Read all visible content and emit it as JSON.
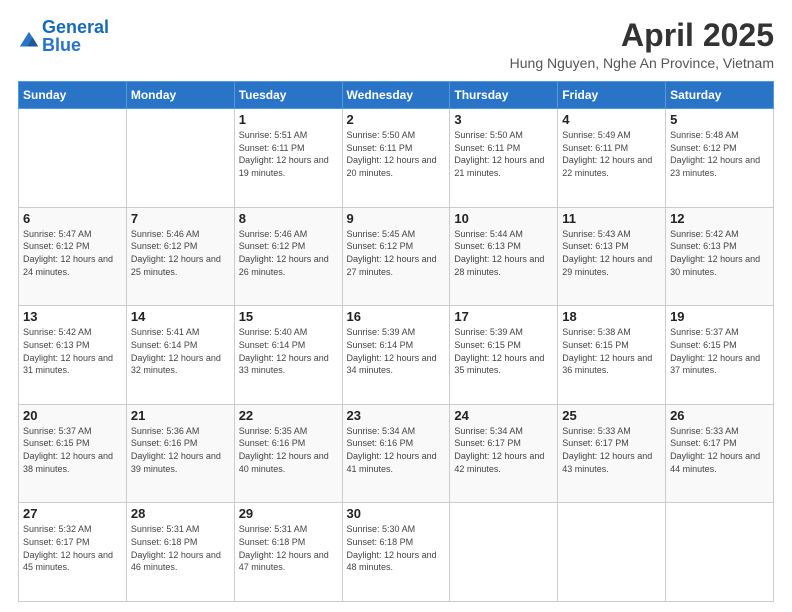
{
  "header": {
    "logo_general": "General",
    "logo_blue": "Blue",
    "month_title": "April 2025",
    "location": "Hung Nguyen, Nghe An Province, Vietnam"
  },
  "weekdays": [
    "Sunday",
    "Monday",
    "Tuesday",
    "Wednesday",
    "Thursday",
    "Friday",
    "Saturday"
  ],
  "weeks": [
    [
      {
        "day": "",
        "sunrise": "",
        "sunset": "",
        "daylight": ""
      },
      {
        "day": "",
        "sunrise": "",
        "sunset": "",
        "daylight": ""
      },
      {
        "day": "1",
        "sunrise": "Sunrise: 5:51 AM",
        "sunset": "Sunset: 6:11 PM",
        "daylight": "Daylight: 12 hours and 19 minutes."
      },
      {
        "day": "2",
        "sunrise": "Sunrise: 5:50 AM",
        "sunset": "Sunset: 6:11 PM",
        "daylight": "Daylight: 12 hours and 20 minutes."
      },
      {
        "day": "3",
        "sunrise": "Sunrise: 5:50 AM",
        "sunset": "Sunset: 6:11 PM",
        "daylight": "Daylight: 12 hours and 21 minutes."
      },
      {
        "day": "4",
        "sunrise": "Sunrise: 5:49 AM",
        "sunset": "Sunset: 6:11 PM",
        "daylight": "Daylight: 12 hours and 22 minutes."
      },
      {
        "day": "5",
        "sunrise": "Sunrise: 5:48 AM",
        "sunset": "Sunset: 6:12 PM",
        "daylight": "Daylight: 12 hours and 23 minutes."
      }
    ],
    [
      {
        "day": "6",
        "sunrise": "Sunrise: 5:47 AM",
        "sunset": "Sunset: 6:12 PM",
        "daylight": "Daylight: 12 hours and 24 minutes."
      },
      {
        "day": "7",
        "sunrise": "Sunrise: 5:46 AM",
        "sunset": "Sunset: 6:12 PM",
        "daylight": "Daylight: 12 hours and 25 minutes."
      },
      {
        "day": "8",
        "sunrise": "Sunrise: 5:46 AM",
        "sunset": "Sunset: 6:12 PM",
        "daylight": "Daylight: 12 hours and 26 minutes."
      },
      {
        "day": "9",
        "sunrise": "Sunrise: 5:45 AM",
        "sunset": "Sunset: 6:12 PM",
        "daylight": "Daylight: 12 hours and 27 minutes."
      },
      {
        "day": "10",
        "sunrise": "Sunrise: 5:44 AM",
        "sunset": "Sunset: 6:13 PM",
        "daylight": "Daylight: 12 hours and 28 minutes."
      },
      {
        "day": "11",
        "sunrise": "Sunrise: 5:43 AM",
        "sunset": "Sunset: 6:13 PM",
        "daylight": "Daylight: 12 hours and 29 minutes."
      },
      {
        "day": "12",
        "sunrise": "Sunrise: 5:42 AM",
        "sunset": "Sunset: 6:13 PM",
        "daylight": "Daylight: 12 hours and 30 minutes."
      }
    ],
    [
      {
        "day": "13",
        "sunrise": "Sunrise: 5:42 AM",
        "sunset": "Sunset: 6:13 PM",
        "daylight": "Daylight: 12 hours and 31 minutes."
      },
      {
        "day": "14",
        "sunrise": "Sunrise: 5:41 AM",
        "sunset": "Sunset: 6:14 PM",
        "daylight": "Daylight: 12 hours and 32 minutes."
      },
      {
        "day": "15",
        "sunrise": "Sunrise: 5:40 AM",
        "sunset": "Sunset: 6:14 PM",
        "daylight": "Daylight: 12 hours and 33 minutes."
      },
      {
        "day": "16",
        "sunrise": "Sunrise: 5:39 AM",
        "sunset": "Sunset: 6:14 PM",
        "daylight": "Daylight: 12 hours and 34 minutes."
      },
      {
        "day": "17",
        "sunrise": "Sunrise: 5:39 AM",
        "sunset": "Sunset: 6:15 PM",
        "daylight": "Daylight: 12 hours and 35 minutes."
      },
      {
        "day": "18",
        "sunrise": "Sunrise: 5:38 AM",
        "sunset": "Sunset: 6:15 PM",
        "daylight": "Daylight: 12 hours and 36 minutes."
      },
      {
        "day": "19",
        "sunrise": "Sunrise: 5:37 AM",
        "sunset": "Sunset: 6:15 PM",
        "daylight": "Daylight: 12 hours and 37 minutes."
      }
    ],
    [
      {
        "day": "20",
        "sunrise": "Sunrise: 5:37 AM",
        "sunset": "Sunset: 6:15 PM",
        "daylight": "Daylight: 12 hours and 38 minutes."
      },
      {
        "day": "21",
        "sunrise": "Sunrise: 5:36 AM",
        "sunset": "Sunset: 6:16 PM",
        "daylight": "Daylight: 12 hours and 39 minutes."
      },
      {
        "day": "22",
        "sunrise": "Sunrise: 5:35 AM",
        "sunset": "Sunset: 6:16 PM",
        "daylight": "Daylight: 12 hours and 40 minutes."
      },
      {
        "day": "23",
        "sunrise": "Sunrise: 5:34 AM",
        "sunset": "Sunset: 6:16 PM",
        "daylight": "Daylight: 12 hours and 41 minutes."
      },
      {
        "day": "24",
        "sunrise": "Sunrise: 5:34 AM",
        "sunset": "Sunset: 6:17 PM",
        "daylight": "Daylight: 12 hours and 42 minutes."
      },
      {
        "day": "25",
        "sunrise": "Sunrise: 5:33 AM",
        "sunset": "Sunset: 6:17 PM",
        "daylight": "Daylight: 12 hours and 43 minutes."
      },
      {
        "day": "26",
        "sunrise": "Sunrise: 5:33 AM",
        "sunset": "Sunset: 6:17 PM",
        "daylight": "Daylight: 12 hours and 44 minutes."
      }
    ],
    [
      {
        "day": "27",
        "sunrise": "Sunrise: 5:32 AM",
        "sunset": "Sunset: 6:17 PM",
        "daylight": "Daylight: 12 hours and 45 minutes."
      },
      {
        "day": "28",
        "sunrise": "Sunrise: 5:31 AM",
        "sunset": "Sunset: 6:18 PM",
        "daylight": "Daylight: 12 hours and 46 minutes."
      },
      {
        "day": "29",
        "sunrise": "Sunrise: 5:31 AM",
        "sunset": "Sunset: 6:18 PM",
        "daylight": "Daylight: 12 hours and 47 minutes."
      },
      {
        "day": "30",
        "sunrise": "Sunrise: 5:30 AM",
        "sunset": "Sunset: 6:18 PM",
        "daylight": "Daylight: 12 hours and 48 minutes."
      },
      {
        "day": "",
        "sunrise": "",
        "sunset": "",
        "daylight": ""
      },
      {
        "day": "",
        "sunrise": "",
        "sunset": "",
        "daylight": ""
      },
      {
        "day": "",
        "sunrise": "",
        "sunset": "",
        "daylight": ""
      }
    ]
  ]
}
